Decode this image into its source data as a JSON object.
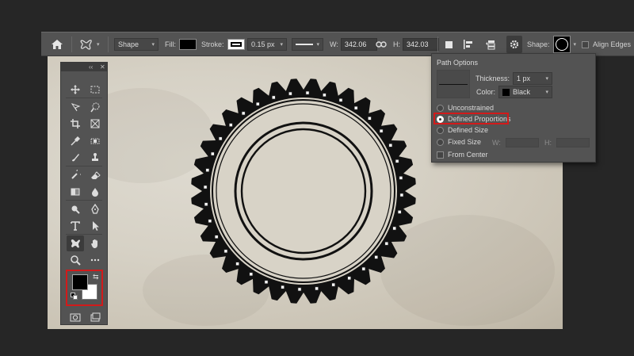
{
  "options_bar": {
    "mode": "Shape",
    "fill_label": "Fill:",
    "stroke_label": "Stroke:",
    "stroke_width": "0.15 px",
    "w_label": "W:",
    "w_value": "342.06",
    "h_label": "H:",
    "h_value": "342.03",
    "shape_label": "Shape:",
    "align_edges": "Align Edges",
    "fill_color": "#000000",
    "stroke_color": "#000000"
  },
  "path_options": {
    "title": "Path Options",
    "thickness_label": "Thickness:",
    "thickness_value": "1 px",
    "color_label": "Color:",
    "color_value": "Black",
    "options": [
      {
        "label": "Unconstrained",
        "selected": false
      },
      {
        "label": "Defined Proportions",
        "selected": true
      },
      {
        "label": "Defined Size",
        "selected": false
      },
      {
        "label": "Fixed Size",
        "selected": false
      }
    ],
    "fixed_w_label": "W:",
    "fixed_h_label": "H:",
    "from_center": "From Center",
    "highlight_color": "#d21a1a"
  },
  "tools_panel": {
    "collapse": "‹‹",
    "close": "✕",
    "icons": [
      "move-icon",
      "marquee-icon",
      "lasso-icon",
      "quick-select-icon",
      "crop-icon",
      "frame-icon",
      "eyedropper-icon",
      "healing-icon",
      "brush-icon",
      "stamp-icon",
      "history-brush-icon",
      "eraser-icon",
      "gradient-icon",
      "blur-icon",
      "dodge-icon",
      "pen-icon",
      "type-icon",
      "path-select-icon",
      "custom-shape-icon",
      "hand-icon",
      "zoom-icon",
      "more-icon"
    ],
    "foreground_color": "#000000",
    "background_color": "#ffffff"
  }
}
